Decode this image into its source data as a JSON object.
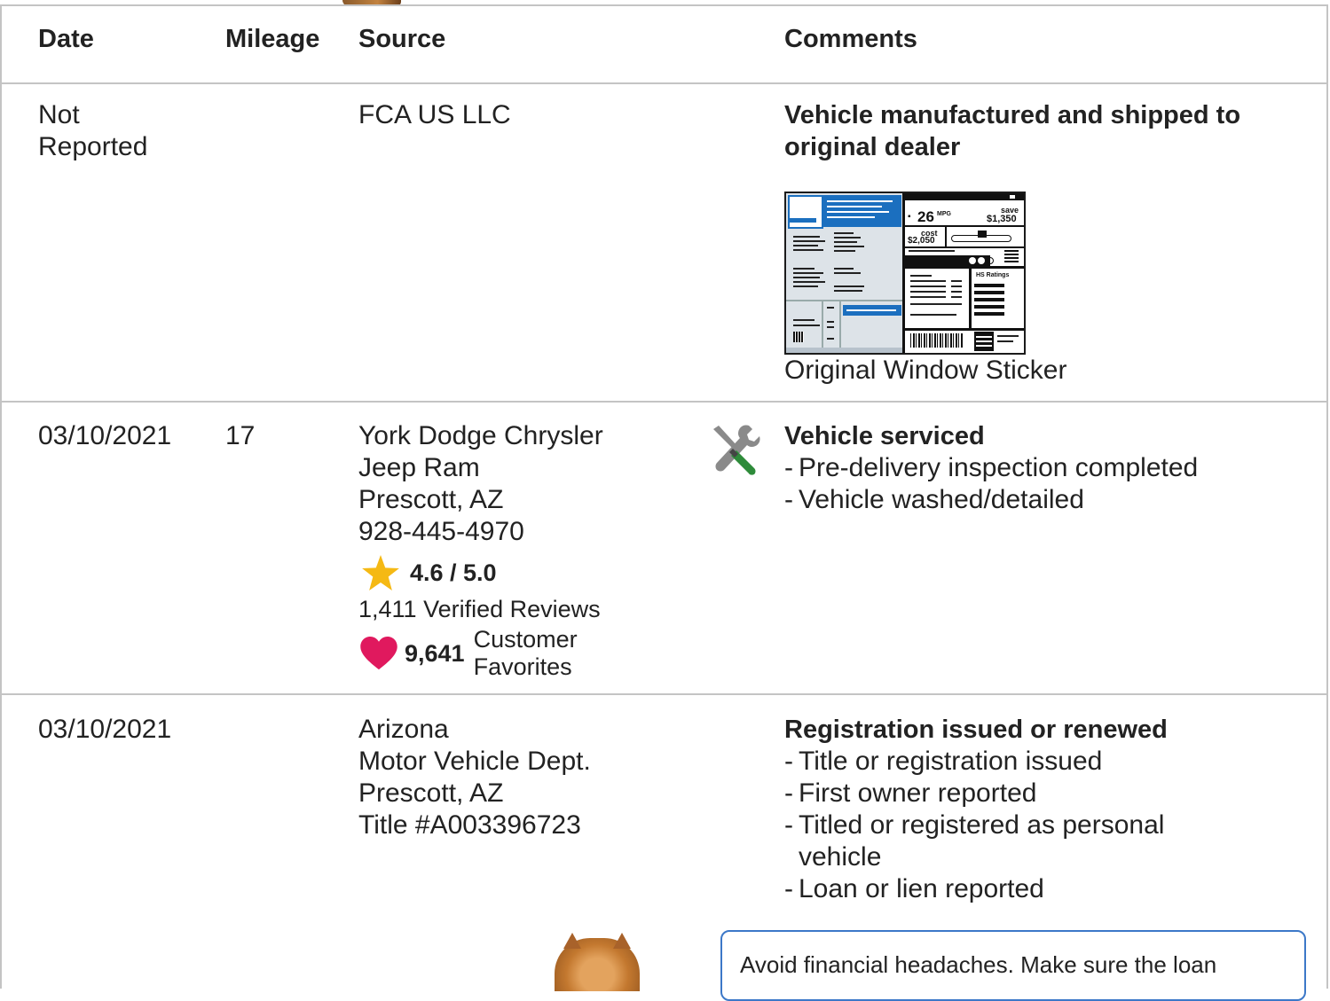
{
  "table": {
    "headers": {
      "date": "Date",
      "mileage": "Mileage",
      "source": "Source",
      "comments": "Comments"
    },
    "records": [
      {
        "date_line1": "Not",
        "date_line2": "Reported",
        "mileage": "",
        "source_line1": "FCA US LLC",
        "comment_title_line1": "Vehicle manufactured and shipped to",
        "comment_title_line2": "original dealer",
        "sticker": {
          "mpg": "26",
          "mpg_unit": "MPG",
          "save_label": "save",
          "save_value": "$1,350",
          "cost_label": "cost",
          "cost_value": "$2,050",
          "ratings_label": "HS Ratings",
          "caption": "Original Window Sticker"
        }
      },
      {
        "date": "03/10/2021",
        "mileage": "17",
        "source_line1": "York Dodge Chrysler",
        "source_line2": "Jeep Ram",
        "source_line3": "Prescott, AZ",
        "source_line4": "928-445-4970",
        "rating": "4.6 / 5.0",
        "reviews": "1,411 Verified Reviews",
        "favorites_count": "9,641",
        "favorites_label_line1": "Customer",
        "favorites_label_line2": "Favorites",
        "service_icon": "wrench-screwdriver-icon",
        "comment_title": "Vehicle serviced",
        "comment_items": [
          "Pre-delivery inspection completed",
          "Vehicle washed/detailed"
        ]
      },
      {
        "date": "03/10/2021",
        "mileage": "",
        "source_line1": "Arizona",
        "source_line2": "Motor Vehicle Dept.",
        "source_line3": "Prescott, AZ",
        "source_line4": "Title #A003396723",
        "comment_title": "Registration issued or renewed",
        "comment_items": [
          "Title or registration issued",
          "First owner reported",
          "Titled or registered as personal vehicle",
          "Loan or lien reported"
        ]
      }
    ]
  },
  "callout": {
    "text": "Avoid financial headaches. Make sure the loan"
  },
  "colors": {
    "border": "#c4c4c4",
    "star": "#f5b914",
    "heart": "#e0195e",
    "callout_border": "#3c78c8",
    "wrench_gray": "#8a8a8a",
    "screwdriver_green": "#2e8b3a"
  }
}
